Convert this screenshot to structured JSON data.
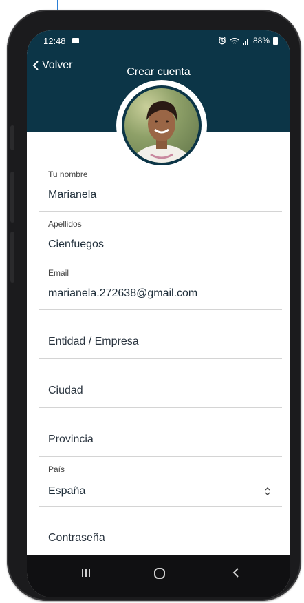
{
  "status_bar": {
    "time": "12:48",
    "battery": "88%"
  },
  "header": {
    "back_label": "Volver",
    "title": "Crear cuenta"
  },
  "form": {
    "nombre": {
      "label": "Tu nombre",
      "value": "Marianela"
    },
    "apellidos": {
      "label": "Apellidos",
      "value": "Cienfuegos"
    },
    "email": {
      "label": "Email",
      "value": "marianela.272638@gmail.com"
    },
    "entidad": {
      "placeholder": "Entidad / Empresa"
    },
    "ciudad": {
      "placeholder": "Ciudad"
    },
    "provincia": {
      "placeholder": "Provincia"
    },
    "pais": {
      "label": "País",
      "value": "España"
    },
    "contrasena": {
      "placeholder": "Contraseña"
    }
  },
  "nav": {
    "recents": "|||",
    "home": "○",
    "back": "‹"
  },
  "colors": {
    "header_bg": "#0c3547",
    "divider": "#d4d4d4"
  }
}
